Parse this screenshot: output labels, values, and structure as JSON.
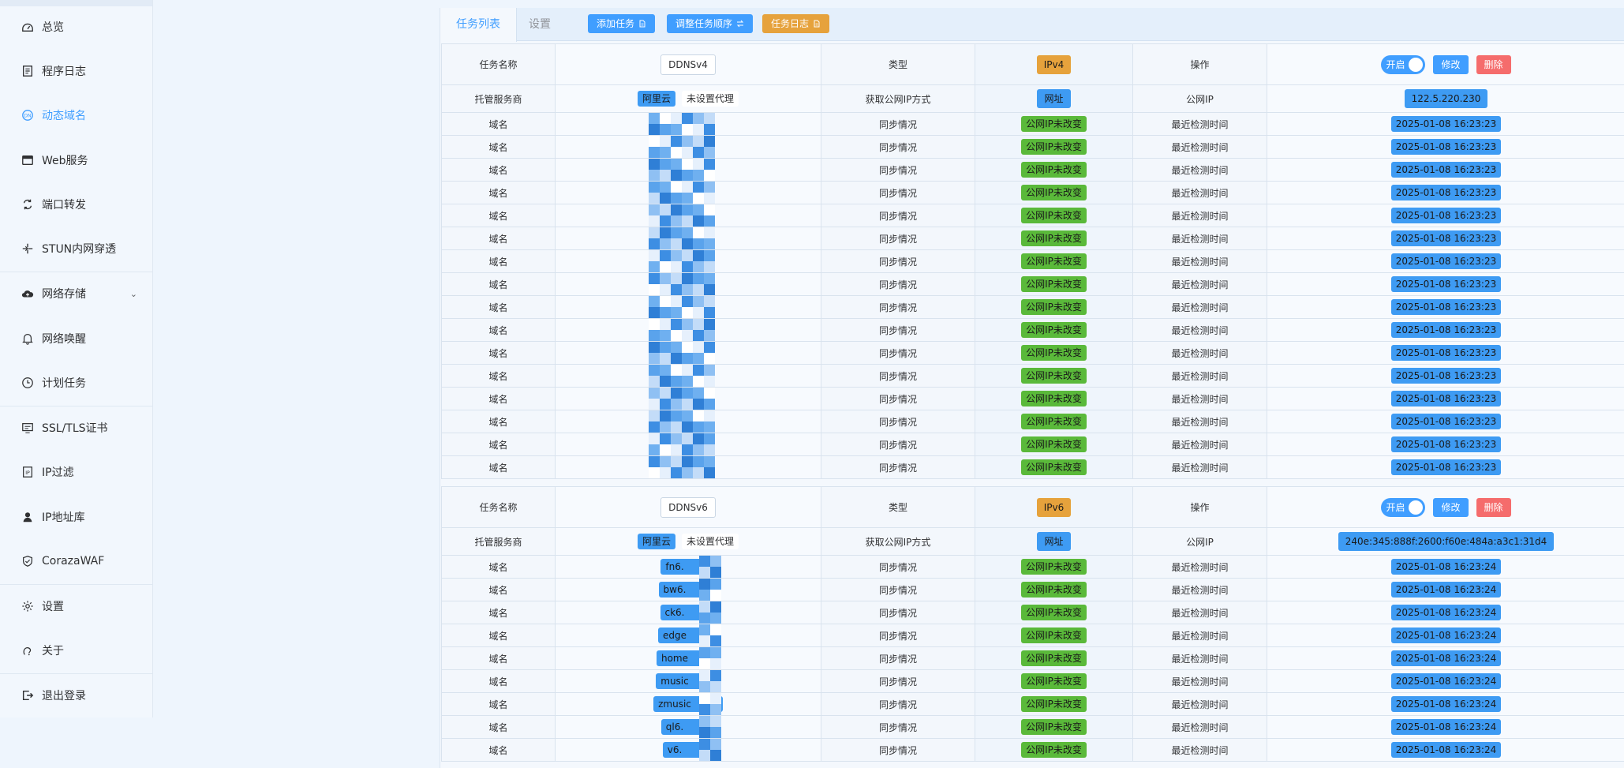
{
  "sidebar": {
    "items": [
      {
        "label": "总览",
        "icon": "dashboard-icon",
        "active": false
      },
      {
        "label": "程序日志",
        "icon": "log-icon",
        "active": false
      },
      {
        "label": "动态域名",
        "icon": "dns-icon",
        "active": true
      },
      {
        "label": "Web服务",
        "icon": "web-icon",
        "active": false
      },
      {
        "label": "端口转发",
        "icon": "port-forward-icon",
        "active": false
      },
      {
        "label": "STUN内网穿透",
        "icon": "stun-icon",
        "active": false
      },
      {
        "label": "网络存储",
        "icon": "cloud-storage-icon",
        "active": false,
        "expandable": true
      },
      {
        "label": "网络唤醒",
        "icon": "bell-icon",
        "active": false
      },
      {
        "label": "计划任务",
        "icon": "clock-icon",
        "active": false
      },
      {
        "label": "SSL/TLS证书",
        "icon": "certificate-icon",
        "active": false
      },
      {
        "label": "IP过滤",
        "icon": "ip-filter-icon",
        "active": false
      },
      {
        "label": "IP地址库",
        "icon": "ip-db-icon",
        "active": false
      },
      {
        "label": "CorazaWAF",
        "icon": "shield-icon",
        "active": false
      },
      {
        "label": "设置",
        "icon": "gear-icon",
        "active": false
      },
      {
        "label": "关于",
        "icon": "about-icon",
        "active": false
      },
      {
        "label": "退出登录",
        "icon": "logout-icon",
        "active": false
      }
    ]
  },
  "tabs": {
    "list": "任务列表",
    "settings": "设置"
  },
  "toolbar": {
    "add": "添加任务",
    "reorder": "调整任务顺序",
    "log": "任务日志"
  },
  "labels": {
    "task_name": "任务名称",
    "type": "类型",
    "operation": "操作",
    "provider": "托管服务商",
    "ip_method": "获取公网IP方式",
    "public_ip": "公网IP",
    "domain": "域名",
    "sync_status": "同步情况",
    "last_check": "最近检测时间",
    "switch_on": "开启",
    "edit": "修改",
    "delete": "删除",
    "proxy": "未设置代理"
  },
  "colors": {
    "accent": "#409eff",
    "success": "#5ab93a",
    "warning": "#e6a23c",
    "danger": "#f56c6c"
  },
  "tasks": [
    {
      "name": "DDNSv4",
      "type": "IPv4",
      "provider": "阿里云",
      "ip_method": "网址",
      "public_ip": "122.5.220.230",
      "enabled": true,
      "records": [
        {
          "domain": "",
          "status": "公网IP未改变",
          "time": "2025-01-08 16:23:23"
        },
        {
          "domain": "",
          "status": "公网IP未改变",
          "time": "2025-01-08 16:23:23"
        },
        {
          "domain": "",
          "status": "公网IP未改变",
          "time": "2025-01-08 16:23:23"
        },
        {
          "domain": "",
          "status": "公网IP未改变",
          "time": "2025-01-08 16:23:23"
        },
        {
          "domain": "",
          "status": "公网IP未改变",
          "time": "2025-01-08 16:23:23"
        },
        {
          "domain": "",
          "status": "公网IP未改变",
          "time": "2025-01-08 16:23:23"
        },
        {
          "domain": "",
          "status": "公网IP未改变",
          "time": "2025-01-08 16:23:23"
        },
        {
          "domain": "",
          "status": "公网IP未改变",
          "time": "2025-01-08 16:23:23"
        },
        {
          "domain": "",
          "status": "公网IP未改变",
          "time": "2025-01-08 16:23:23"
        },
        {
          "domain": "",
          "status": "公网IP未改变",
          "time": "2025-01-08 16:23:23"
        },
        {
          "domain": "",
          "status": "公网IP未改变",
          "time": "2025-01-08 16:23:23"
        },
        {
          "domain": "",
          "status": "公网IP未改变",
          "time": "2025-01-08 16:23:23"
        },
        {
          "domain": "",
          "status": "公网IP未改变",
          "time": "2025-01-08 16:23:23"
        },
        {
          "domain": "",
          "status": "公网IP未改变",
          "time": "2025-01-08 16:23:23"
        },
        {
          "domain": "",
          "status": "公网IP未改变",
          "time": "2025-01-08 16:23:23"
        },
        {
          "domain": "",
          "status": "公网IP未改变",
          "time": "2025-01-08 16:23:23"
        }
      ]
    },
    {
      "name": "DDNSv6",
      "type": "IPv6",
      "provider": "阿里云",
      "ip_method": "网址",
      "public_ip": "240e:345:888f:2600:f60e:484a:a3c1:31d4",
      "enabled": true,
      "records": [
        {
          "domain": "fn6.",
          "status": "公网IP未改变",
          "time": "2025-01-08 16:23:24"
        },
        {
          "domain": "bw6.",
          "status": "公网IP未改变",
          "time": "2025-01-08 16:23:24"
        },
        {
          "domain": "ck6.",
          "status": "公网IP未改变",
          "time": "2025-01-08 16:23:24"
        },
        {
          "domain": "edge",
          "status": "公网IP未改变",
          "time": "2025-01-08 16:23:24"
        },
        {
          "domain": "home",
          "status": "公网IP未改变",
          "time": "2025-01-08 16:23:24"
        },
        {
          "domain": "music",
          "status": "公网IP未改变",
          "time": "2025-01-08 16:23:24"
        },
        {
          "domain": "zmusic",
          "status": "公网IP未改变",
          "time": "2025-01-08 16:23:24"
        },
        {
          "domain": "ql6.",
          "status": "公网IP未改变",
          "time": "2025-01-08 16:23:24"
        },
        {
          "domain": "v6.",
          "status": "公网IP未改变",
          "time": "2025-01-08 16:23:24"
        }
      ]
    }
  ]
}
